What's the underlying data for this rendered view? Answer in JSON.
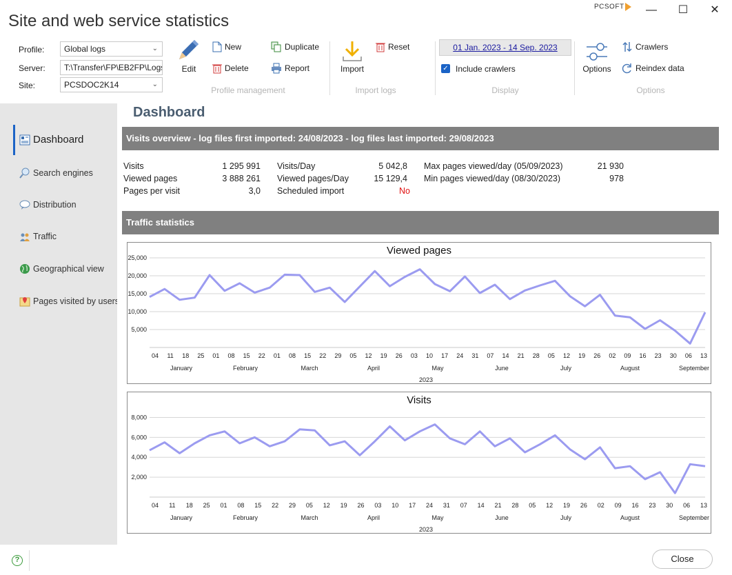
{
  "window": {
    "title": "Site and web service statistics",
    "brand": "PCSOFT",
    "minimize": "—",
    "maximize": "☐",
    "close": "✕"
  },
  "ribbon": {
    "profile_label": "Profile:",
    "profile_value": "Global logs",
    "server_label": "Server:",
    "server_value": "T:\\Transfer\\FP\\EB2FP\\Logs",
    "site_label": "Site:",
    "site_value": "PCSDOC2K14",
    "edit": "Edit",
    "new": "New",
    "delete": "Delete",
    "duplicate": "Duplicate",
    "report": "Report",
    "profile_group": "Profile management",
    "import": "Import",
    "reset": "Reset",
    "import_group": "Import logs",
    "date_range": "01 Jan. 2023 - 14 Sep. 2023",
    "include_crawlers": "Include crawlers",
    "display_group": "Display",
    "options": "Options",
    "crawlers": "Crawlers",
    "reindex": "Reindex data",
    "options_group": "Options"
  },
  "sidebar": {
    "items": [
      {
        "label": "Dashboard",
        "icon": "dashboard-icon"
      },
      {
        "label": "Search engines",
        "icon": "magnifier-icon"
      },
      {
        "label": "Distribution",
        "icon": "speech-bubble-icon"
      },
      {
        "label": "Traffic",
        "icon": "traffic-icon"
      },
      {
        "label": "Geographical view",
        "icon": "globe-icon"
      },
      {
        "label": "Pages visited by users",
        "icon": "map-pin-icon"
      }
    ]
  },
  "dashboard": {
    "title": "Dashboard",
    "overview_header": "Visits overview  - log files first imported: 24/08/2023 - log files last imported: 29/08/2023",
    "stats": {
      "visits_label": "Visits",
      "visits_value": "1 295 991",
      "viewed_pages_label": "Viewed pages",
      "viewed_pages_value": "3 888 261",
      "ppv_label": "Pages per visit",
      "ppv_value": "3,0",
      "visits_day_label": "Visits/Day",
      "visits_day_value": "5 042,8",
      "pages_day_label": "Viewed pages/Day",
      "pages_day_value": "15 129,4",
      "sched_label": "Scheduled import",
      "sched_value": "No",
      "max_label": "Max pages viewed/day (05/09/2023)",
      "max_value": "21 930",
      "min_label": "Min pages viewed/day (08/30/2023)",
      "min_value": "978"
    },
    "traffic_header": "Traffic statistics"
  },
  "chart_data": [
    {
      "type": "line",
      "title": "Viewed pages",
      "xlabel": "2023",
      "ylim": [
        0,
        25000
      ],
      "yticks": [
        "5,000",
        "10,000",
        "15,000",
        "20,000",
        "25,000"
      ],
      "xticks": [
        "04",
        "11",
        "18",
        "25",
        "01",
        "08",
        "15",
        "22",
        "01",
        "08",
        "15",
        "22",
        "29",
        "05",
        "12",
        "19",
        "26",
        "03",
        "10",
        "17",
        "24",
        "31",
        "07",
        "14",
        "21",
        "28",
        "05",
        "12",
        "19",
        "26",
        "02",
        "09",
        "16",
        "23",
        "30",
        "06",
        "13"
      ],
      "months": [
        "January",
        "February",
        "March",
        "April",
        "May",
        "June",
        "July",
        "August",
        "September"
      ],
      "color": "#9b9bf0",
      "values": [
        14100,
        16300,
        13300,
        13900,
        20200,
        15800,
        17900,
        15300,
        16700,
        20300,
        20200,
        15500,
        16700,
        12700,
        17000,
        21300,
        17100,
        19700,
        21800,
        17700,
        15700,
        19800,
        15200,
        17500,
        13500,
        15900,
        17300,
        18600,
        14300,
        11500,
        14700,
        8900,
        8400,
        5200,
        7600,
        4700,
        1100,
        9800
      ]
    },
    {
      "type": "line",
      "title": "Visits",
      "xlabel": "2023",
      "ylim": [
        0,
        9000
      ],
      "yticks": [
        "2,000",
        "4,000",
        "6,000",
        "8,000"
      ],
      "xticks": [
        "04",
        "11",
        "18",
        "25",
        "01",
        "08",
        "15",
        "22",
        "29",
        "05",
        "12",
        "19",
        "26",
        "03",
        "10",
        "17",
        "24",
        "31",
        "07",
        "14",
        "21",
        "28",
        "05",
        "12",
        "19",
        "26",
        "02",
        "09",
        "16",
        "23",
        "30",
        "06",
        "13"
      ],
      "months": [
        "January",
        "February",
        "March",
        "April",
        "May",
        "June",
        "July",
        "August",
        "September"
      ],
      "color": "#9b9bf0",
      "values": [
        4700,
        5500,
        4400,
        5400,
        6200,
        6600,
        5400,
        6000,
        5100,
        5600,
        6800,
        6700,
        5200,
        5600,
        4200,
        5600,
        7100,
        5700,
        6600,
        7300,
        5900,
        5300,
        6600,
        5100,
        5900,
        4500,
        5300,
        6200,
        4800,
        3800,
        5000,
        2900,
        3100,
        1800,
        2500,
        400,
        3300,
        3100
      ]
    }
  ],
  "footer": {
    "help": "?",
    "close": "Close"
  }
}
